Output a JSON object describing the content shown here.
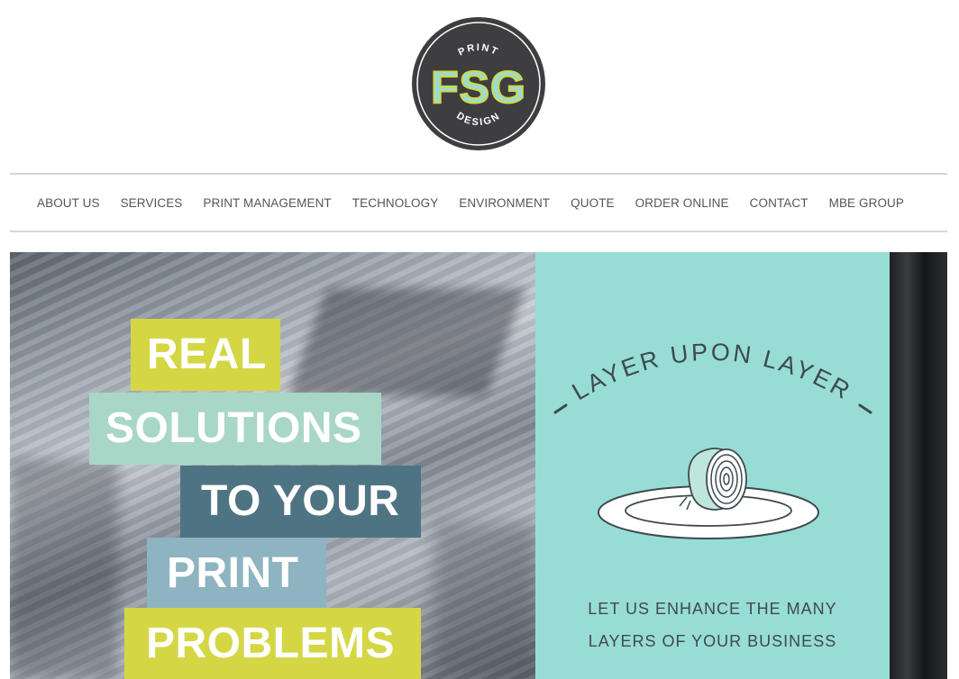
{
  "logo": {
    "top_text": "PRINT",
    "mark": "FSG",
    "bottom_text": "DESIGN"
  },
  "nav": {
    "items": [
      {
        "label": "ABOUT US"
      },
      {
        "label": "SERVICES"
      },
      {
        "label": "PRINT MANAGEMENT"
      },
      {
        "label": "TECHNOLOGY"
      },
      {
        "label": "ENVIRONMENT"
      },
      {
        "label": "QUOTE"
      },
      {
        "label": "ORDER ONLINE"
      },
      {
        "label": "CONTACT"
      },
      {
        "label": "MBE GROUP"
      }
    ]
  },
  "hero": {
    "headline": [
      "REAL",
      "SOLUTIONS",
      "TO YOUR",
      "PRINT",
      "PROBLEMS"
    ],
    "panel": {
      "arc_title": "LAYER UPON LAYER",
      "illustration": "onion-on-plate-icon",
      "tagline_line1": "LET US ENHANCE THE MANY",
      "tagline_line2": "LAYERS OF YOUR BUSINESS"
    }
  },
  "colors": {
    "nav_text": "#555555",
    "lime": "#d4d743",
    "mint": "#a8d6c7",
    "slate": "#4e7483",
    "steel_blue": "#8eb3c1",
    "teal_panel": "#98ddd5",
    "logo_dark": "#3e3e40"
  }
}
